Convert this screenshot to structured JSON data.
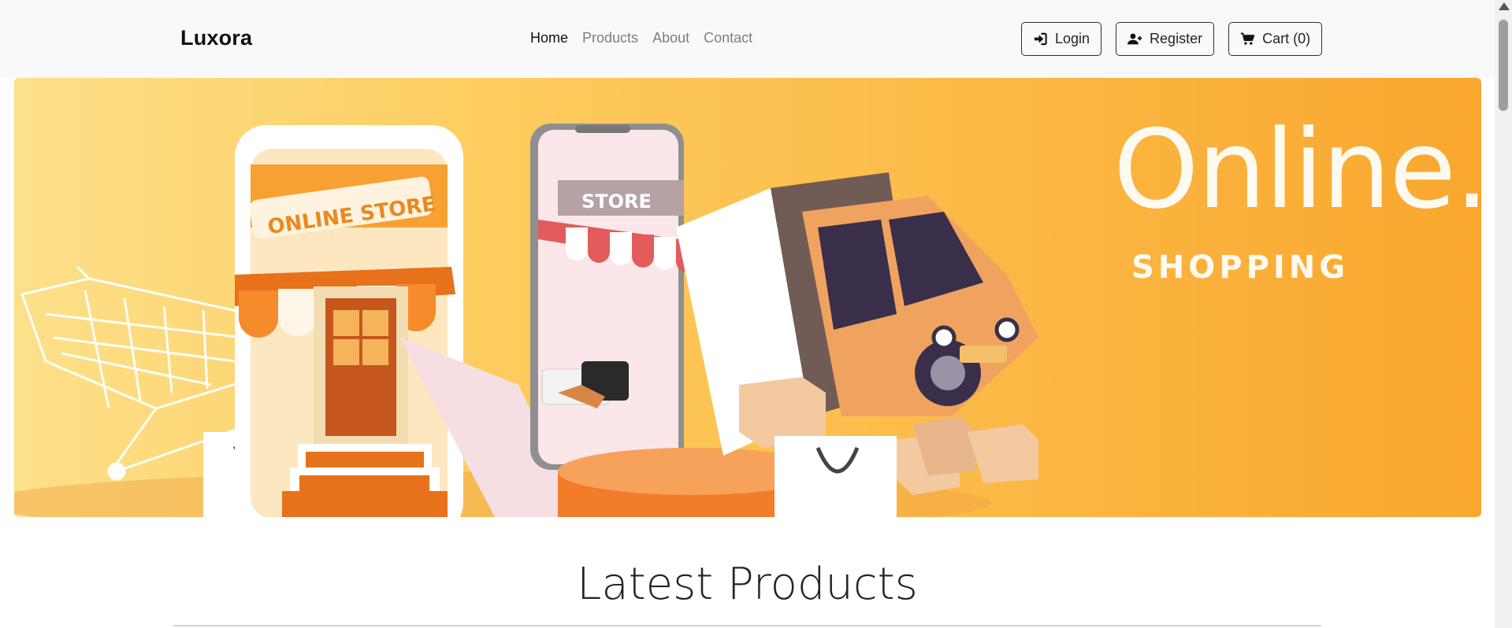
{
  "navbar": {
    "brand": "Luxora",
    "links": [
      {
        "label": "Home",
        "active": true
      },
      {
        "label": "Products",
        "active": false
      },
      {
        "label": "About",
        "active": false
      },
      {
        "label": "Contact",
        "active": false
      }
    ],
    "buttons": {
      "login": {
        "label": "Login",
        "icon": "sign-in-icon"
      },
      "register": {
        "label": "Register",
        "icon": "user-plus-icon"
      },
      "cart": {
        "label": "Cart (0)",
        "icon": "cart-icon"
      }
    }
  },
  "hero": {
    "title": "Online.",
    "subtitle": "SHOPPING",
    "store_sign": "ONLINE STORE",
    "phone_sign": "STORE",
    "colors": {
      "bg_start": "#fde08a",
      "bg_end": "#f9a72e",
      "accent": "#e8711c"
    }
  },
  "section": {
    "title": "Latest Products"
  }
}
